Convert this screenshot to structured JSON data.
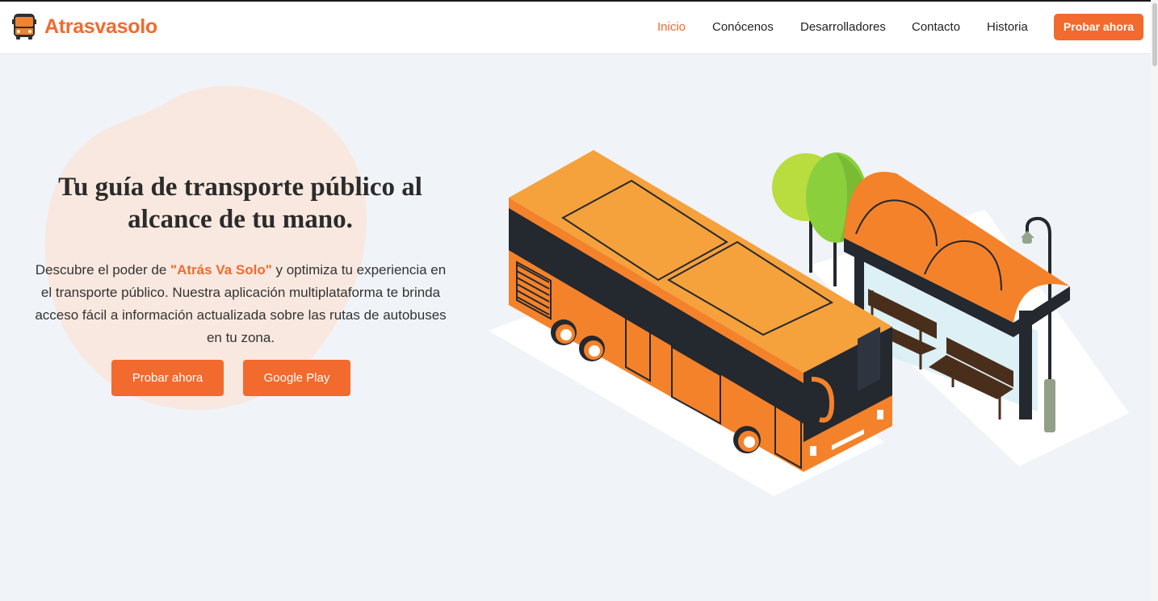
{
  "nav": {
    "brand": "Atrasvasolo",
    "links": [
      "Inicio",
      "Conócenos",
      "Desarrolladores",
      "Contacto",
      "Historia"
    ],
    "active": "Inicio",
    "cta": "Probar ahora"
  },
  "hero": {
    "title": "Tu guía de transporte público al alcance de tu mano.",
    "text_before": "Descubre el poder de ",
    "highlight": "\"Atrás Va Solo\"",
    "text_after": " y optimiza tu experiencia en el transporte público. Nuestra aplicación multiplataforma te brinda acceso fácil a información actualizada sobre las rutas de autobuses en tu zona.",
    "btn_try": "Probar ahora",
    "btn_play": "Google Play"
  },
  "icons": {
    "brand_logo": "bus-icon",
    "illustration": "bus-stop-illustration"
  },
  "colors": {
    "accent": "#f26a2e",
    "background": "#f0f3f8",
    "bus_orange": "#f4822a",
    "bus_dark": "#24282f"
  }
}
